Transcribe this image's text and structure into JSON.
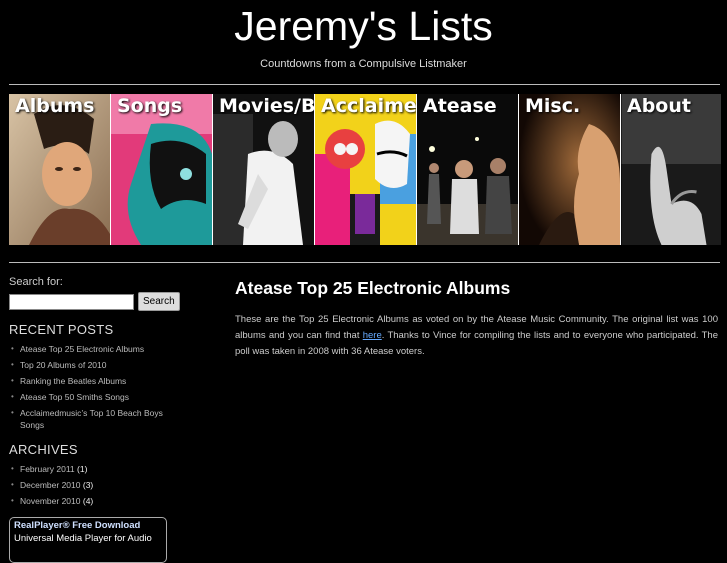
{
  "site": {
    "title": "Jeremy's Lists",
    "tagline": "Countdowns from a Compulsive Listmaker"
  },
  "nav": {
    "tiles": [
      {
        "label": "Albums",
        "icon": "elvis-portrait-image"
      },
      {
        "label": "Songs",
        "icon": "pop-art-profile-image"
      },
      {
        "label": "Movies/Books",
        "icon": "person-in-white-shirt-image"
      },
      {
        "label": "Acclaimedmusic",
        "icon": "psychedelic-beatles-image"
      },
      {
        "label": "Atease",
        "icon": "band-photo-image"
      },
      {
        "label": "Misc.",
        "icon": "dark-portrait-image"
      },
      {
        "label": "About",
        "icon": "hand-gesture-image"
      }
    ]
  },
  "sidebar": {
    "search_label": "Search for:",
    "search_button": "Search",
    "search_value": "",
    "recent_heading": "RECENT POSTS",
    "recent_posts": [
      "Atease Top 25 Electronic Albums",
      "Top 20 Albums of 2010",
      "Ranking the Beatles Albums",
      "Atease Top 50 Smiths Songs",
      "Acclaimedmusic’s Top 10 Beach Boys Songs"
    ],
    "archives_heading": "ARCHIVES",
    "archives": [
      {
        "label": "February 2011",
        "count": "(1)"
      },
      {
        "label": "December 2010",
        "count": "(3)"
      },
      {
        "label": "November 2010",
        "count": "(4)"
      }
    ],
    "ad": {
      "title": "RealPlayer® Free Download",
      "subtitle": "Universal Media Player for Audio"
    }
  },
  "post": {
    "title": "Atease Top 25 Electronic Albums",
    "body_before": "These are the Top 25 Electronic Albums as voted on by the Atease Music Community. The original list was 100 albums and you can find that ",
    "link_text": "here",
    "body_after": ". Thanks to Vince for compiling the lists and to everyone who participated.  The poll was taken in 2008 with 36 Atease voters."
  }
}
